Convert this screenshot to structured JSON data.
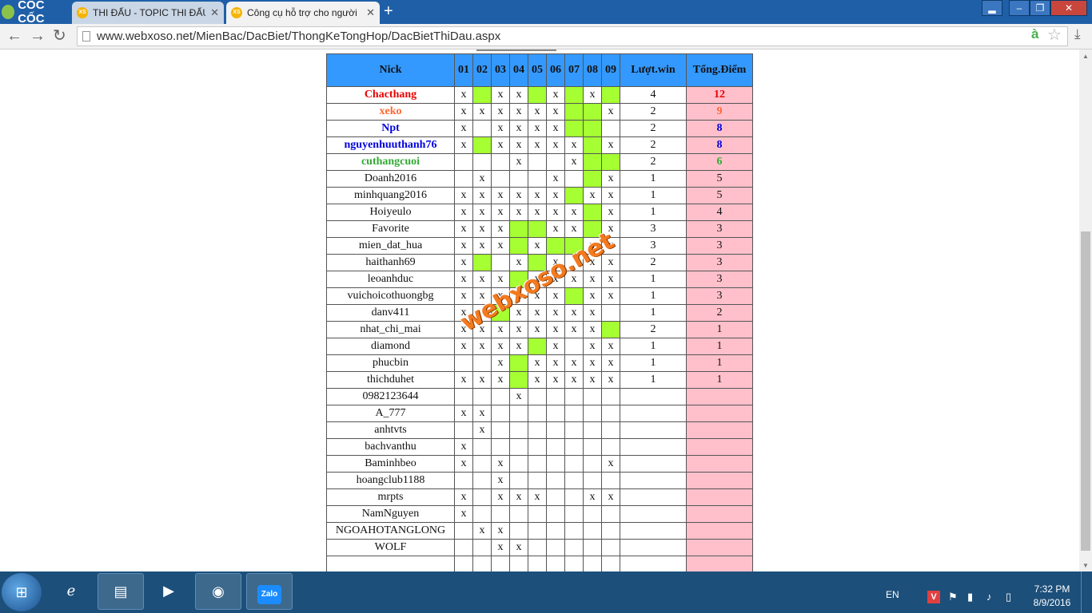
{
  "browser": {
    "logo_text": "CỐC CỐC",
    "tabs": [
      {
        "label": "THI ĐẤU - TOPIC THI ĐẤU",
        "favicon": "XS",
        "active": false
      },
      {
        "label": "Công cụ hỗ trợ cho người",
        "favicon": "XS",
        "active": true
      }
    ],
    "new_tab": "+",
    "url": "www.webxoso.net/MienBac/DacBiet/ThongKeTongHop/DacBietThiDau.aspx",
    "ext_icon": "à"
  },
  "table": {
    "headers": {
      "nick": "Nick",
      "cols": [
        "01",
        "02",
        "03",
        "04",
        "05",
        "06",
        "07",
        "08",
        "09"
      ],
      "wins": "Lượt.win",
      "total": "Tổng.Điểm"
    },
    "rows": [
      {
        "nick": "Chacthang",
        "cells": [
          "x",
          "",
          "x",
          "x",
          "",
          "x",
          "",
          "x",
          ""
        ],
        "green": [
          1,
          4,
          6,
          8
        ],
        "wins": "4",
        "total": "12",
        "style": "r1"
      },
      {
        "nick": "xeko",
        "cells": [
          "x",
          "x",
          "x",
          "x",
          "x",
          "x",
          "",
          "",
          "x"
        ],
        "green": [
          6,
          7
        ],
        "wins": "2",
        "total": "9",
        "style": "r2"
      },
      {
        "nick": "Npt",
        "cells": [
          "x",
          "",
          "x",
          "x",
          "x",
          "x",
          "",
          "",
          ""
        ],
        "green": [
          6,
          7
        ],
        "wins": "2",
        "total": "8",
        "style": "r3"
      },
      {
        "nick": "nguyenhuuthanh76",
        "cells": [
          "x",
          "",
          "x",
          "x",
          "x",
          "x",
          "x",
          "",
          "x"
        ],
        "green": [
          1,
          7
        ],
        "wins": "2",
        "total": "8",
        "style": "r3"
      },
      {
        "nick": "cuthangcuoi",
        "cells": [
          "",
          "",
          "",
          "x",
          "",
          "",
          "x",
          "",
          ""
        ],
        "green": [
          7,
          8
        ],
        "wins": "2",
        "total": "6",
        "style": "r5"
      },
      {
        "nick": "Doanh2016",
        "cells": [
          "",
          "x",
          "",
          "",
          "",
          "x",
          "",
          "",
          "x"
        ],
        "green": [
          7
        ],
        "wins": "1",
        "total": "5",
        "style": ""
      },
      {
        "nick": "minhquang2016",
        "cells": [
          "x",
          "x",
          "x",
          "x",
          "x",
          "x",
          "",
          "x",
          "x"
        ],
        "green": [
          6
        ],
        "wins": "1",
        "total": "5",
        "style": ""
      },
      {
        "nick": "Hoiyeulo",
        "cells": [
          "x",
          "x",
          "x",
          "x",
          "x",
          "x",
          "x",
          "",
          "x"
        ],
        "green": [
          7
        ],
        "wins": "1",
        "total": "4",
        "style": ""
      },
      {
        "nick": "Favorite",
        "cells": [
          "x",
          "x",
          "x",
          "",
          "",
          "x",
          "x",
          "",
          "x"
        ],
        "green": [
          3,
          4,
          7
        ],
        "wins": "3",
        "total": "3",
        "style": ""
      },
      {
        "nick": "mien_dat_hua",
        "cells": [
          "x",
          "x",
          "x",
          "",
          "x",
          "",
          "",
          "x",
          "x"
        ],
        "green": [
          3,
          5,
          6
        ],
        "wins": "3",
        "total": "3",
        "style": ""
      },
      {
        "nick": "haithanh69",
        "cells": [
          "x",
          "",
          "",
          "x",
          "",
          "x",
          "",
          "x",
          "x"
        ],
        "green": [
          1,
          4
        ],
        "wins": "2",
        "total": "3",
        "style": ""
      },
      {
        "nick": "leoanhduc",
        "cells": [
          "x",
          "x",
          "x",
          "",
          "x",
          "x",
          "x",
          "x",
          "x"
        ],
        "green": [
          3
        ],
        "wins": "1",
        "total": "3",
        "style": ""
      },
      {
        "nick": "vuichoicothuongbg",
        "cells": [
          "x",
          "x",
          "x",
          "x",
          "x",
          "x",
          "",
          "x",
          "x"
        ],
        "green": [
          6
        ],
        "wins": "1",
        "total": "3",
        "style": ""
      },
      {
        "nick": "danv411",
        "cells": [
          "x",
          "",
          "",
          "x",
          "x",
          "x",
          "x",
          "x",
          ""
        ],
        "green": [
          2
        ],
        "wins": "1",
        "total": "2",
        "style": ""
      },
      {
        "nick": "nhat_chi_mai",
        "cells": [
          "x",
          "x",
          "x",
          "x",
          "x",
          "x",
          "x",
          "x",
          ""
        ],
        "green": [
          8
        ],
        "wins": "2",
        "total": "1",
        "style": ""
      },
      {
        "nick": "diamond",
        "cells": [
          "x",
          "x",
          "x",
          "x",
          "",
          "x",
          "",
          "x",
          "x"
        ],
        "green": [
          4
        ],
        "wins": "1",
        "total": "1",
        "style": ""
      },
      {
        "nick": "phucbin",
        "cells": [
          "",
          "",
          "x",
          "",
          "x",
          "x",
          "x",
          "x",
          "x"
        ],
        "green": [
          3
        ],
        "wins": "1",
        "total": "1",
        "style": ""
      },
      {
        "nick": "thichduhet",
        "cells": [
          "x",
          "x",
          "x",
          "",
          "x",
          "x",
          "x",
          "x",
          "x"
        ],
        "green": [
          3
        ],
        "wins": "1",
        "total": "1",
        "style": ""
      },
      {
        "nick": "0982123644",
        "cells": [
          "",
          "",
          "",
          "x",
          "",
          "",
          "",
          "",
          ""
        ],
        "green": [],
        "wins": "",
        "total": "",
        "style": ""
      },
      {
        "nick": "A_777",
        "cells": [
          "x",
          "x",
          "",
          "",
          "",
          "",
          "",
          "",
          ""
        ],
        "green": [],
        "wins": "",
        "total": "",
        "style": ""
      },
      {
        "nick": "anhtvts",
        "cells": [
          "",
          "x",
          "",
          "",
          "",
          "",
          "",
          "",
          ""
        ],
        "green": [],
        "wins": "",
        "total": "",
        "style": ""
      },
      {
        "nick": "bachvanthu",
        "cells": [
          "x",
          "",
          "",
          "",
          "",
          "",
          "",
          "",
          ""
        ],
        "green": [],
        "wins": "",
        "total": "",
        "style": ""
      },
      {
        "nick": "Baminhbeo",
        "cells": [
          "x",
          "",
          "x",
          "",
          "",
          "",
          "",
          "",
          "x"
        ],
        "green": [],
        "wins": "",
        "total": "",
        "style": ""
      },
      {
        "nick": "hoangclub1188",
        "cells": [
          "",
          "",
          "x",
          "",
          "",
          "",
          "",
          "",
          ""
        ],
        "green": [],
        "wins": "",
        "total": "",
        "style": ""
      },
      {
        "nick": "mrpts",
        "cells": [
          "x",
          "",
          "x",
          "x",
          "x",
          "",
          "",
          "x",
          "x"
        ],
        "green": [],
        "wins": "",
        "total": "",
        "style": ""
      },
      {
        "nick": "NamNguyen",
        "cells": [
          "x",
          "",
          "",
          "",
          "",
          "",
          "",
          "",
          ""
        ],
        "green": [],
        "wins": "",
        "total": "",
        "style": ""
      },
      {
        "nick": "NGOAHOTANGLONG",
        "cells": [
          "",
          "x",
          "x",
          "",
          "",
          "",
          "",
          "",
          ""
        ],
        "green": [],
        "wins": "",
        "total": "",
        "style": ""
      },
      {
        "nick": "WOLF",
        "cells": [
          "",
          "",
          "x",
          "x",
          "",
          "",
          "",
          "",
          ""
        ],
        "green": [],
        "wins": "",
        "total": "",
        "style": ""
      },
      {
        "nick": "",
        "cells": [
          "",
          "",
          "",
          "",
          "",
          "",
          "",
          "",
          ""
        ],
        "green": [],
        "wins": "",
        "total": "",
        "style": ""
      }
    ],
    "colors": {
      "header_bg": "#3399ff",
      "win_green": "#a6ff33",
      "total_bg": "#ffc0cb",
      "rank1": "#e80000",
      "rank2": "#ff6633",
      "rank3": "#0000dd",
      "rank5": "#33aa33"
    }
  },
  "watermark": "webxoso.net",
  "taskbar": {
    "zalo_label": "Zalo",
    "language": "EN",
    "time": "7:32 PM",
    "date": "8/9/2016"
  }
}
